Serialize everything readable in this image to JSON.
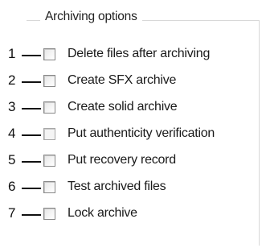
{
  "group": {
    "title": "Archiving options"
  },
  "options": [
    {
      "number": "1",
      "label": "Delete files after archiving",
      "checked": false
    },
    {
      "number": "2",
      "label": "Create SFX archive",
      "checked": false
    },
    {
      "number": "3",
      "label": "Create solid archive",
      "checked": false
    },
    {
      "number": "4",
      "label": "Put authenticity verification",
      "checked": false
    },
    {
      "number": "5",
      "label": "Put recovery record",
      "checked": false
    },
    {
      "number": "6",
      "label": "Test archived files",
      "checked": false
    },
    {
      "number": "7",
      "label": "Lock archive",
      "checked": false
    }
  ]
}
